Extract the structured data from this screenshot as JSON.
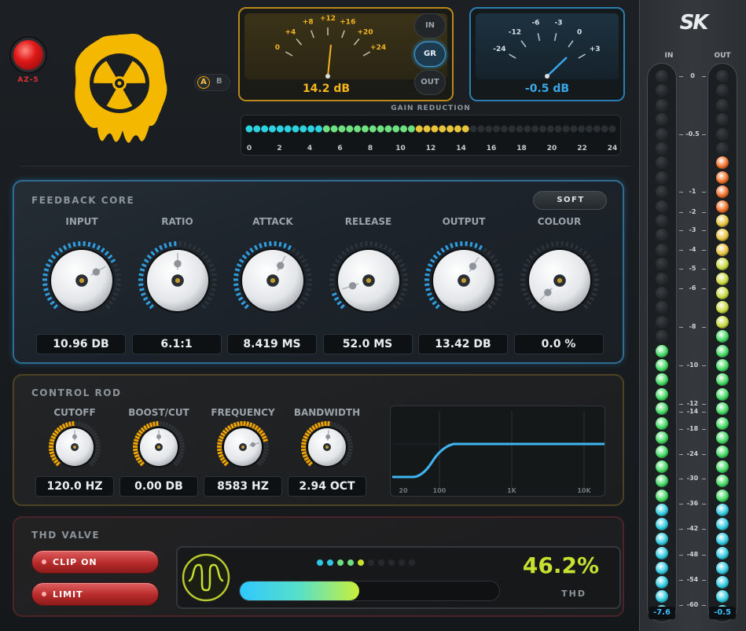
{
  "app": {
    "brand": "SK"
  },
  "power": {
    "label": "AZ-5"
  },
  "ab": {
    "a": "A",
    "b": "B"
  },
  "meter_in": {
    "value": "14.2 dB",
    "scale": [
      "0",
      "+4",
      "+8",
      "+12",
      "+16",
      "+20",
      "+24"
    ]
  },
  "meter_mode": {
    "in": "IN",
    "gr": "GR",
    "out": "OUT",
    "selected": "GR"
  },
  "meter_out": {
    "value": "-0.5 dB",
    "scale": [
      "-24",
      "-12",
      "-6",
      "-3",
      "0",
      "+3"
    ]
  },
  "gain_reduction": {
    "title": "GAIN REDUCTION",
    "scale": [
      "0",
      "2",
      "4",
      "6",
      "8",
      "10",
      "12",
      "14",
      "16",
      "18",
      "20",
      "22",
      "24"
    ],
    "lit": 0.6
  },
  "feedback_core": {
    "title": "FEEDBACK CORE",
    "mode": "SOFT",
    "knobs": [
      {
        "label": "INPUT",
        "value": "10.96 DB",
        "level": 0.72
      },
      {
        "label": "RATIO",
        "value": "6.1:1",
        "level": 0.5
      },
      {
        "label": "ATTACK",
        "value": "8.419 MS",
        "level": 0.6
      },
      {
        "label": "RELEASE",
        "value": "52.0 MS",
        "level": 0.1
      },
      {
        "label": "OUTPUT",
        "value": "13.42 DB",
        "level": 0.62
      },
      {
        "label": "COLOUR",
        "value": "0.0 %",
        "level": 0
      }
    ]
  },
  "control_rod": {
    "title": "CONTROL ROD",
    "knobs": [
      {
        "label": "CUTOFF",
        "value": "120.0 HZ",
        "level": 0.5
      },
      {
        "label": "BOOST/CUT",
        "value": "0.00 DB",
        "level": 0.5
      },
      {
        "label": "FREQUENCY",
        "value": "8583 HZ",
        "level": 0.78
      },
      {
        "label": "BANDWIDTH",
        "value": "2.94 OCT",
        "level": 0.52
      }
    ],
    "eq_axis": [
      "20",
      "100",
      "1K",
      "10K"
    ]
  },
  "thd_valve": {
    "title": "THD VALVE",
    "clip": "CLIP ON",
    "limit": "LIMIT",
    "percent": "46.2%",
    "label": "THD",
    "bar_level": 0.46,
    "dots_lit": 5,
    "dots_total": 10
  },
  "meters": {
    "in_label": "IN",
    "out_label": "OUT",
    "in_value": "-7.6",
    "out_value": "-0.5",
    "scale": [
      "0",
      "-0.5",
      "-1",
      "-2",
      "-3",
      "-4",
      "-5",
      "-6",
      "-8",
      "-10",
      "-12",
      "-14",
      "-18",
      "-24",
      "-30",
      "-36",
      "-42",
      "-48",
      "-54",
      "-60"
    ],
    "in_lit": 19,
    "out_lit": 32,
    "total": 38
  },
  "colors": {
    "accent_blue": "#2f9ee0",
    "accent_orange": "#f0a400",
    "danger": "#c83030",
    "lime": "#c8e030"
  }
}
